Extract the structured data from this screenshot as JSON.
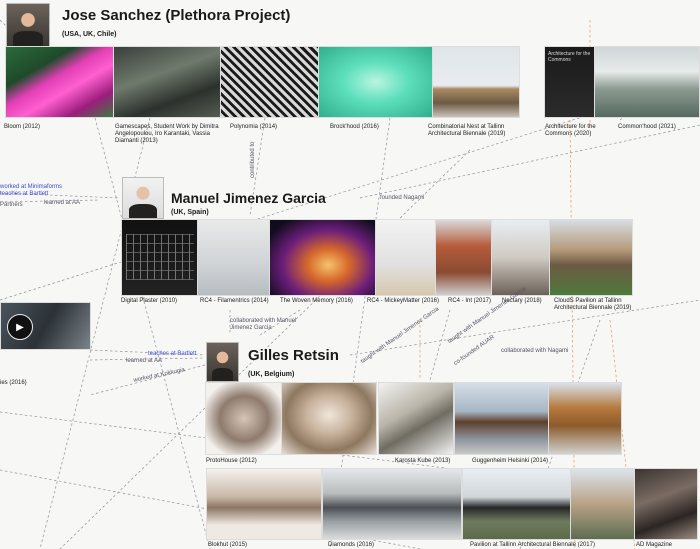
{
  "people": [
    {
      "name": "Jose Sanchez (Plethora Project)",
      "location": "(USA, UK, Chile)"
    },
    {
      "name": "Manuel Jimenez Garcia",
      "location": "(UK, Spain)"
    },
    {
      "name": "Gilles Retsin",
      "location": "(UK, Belgium)"
    }
  ],
  "projects": {
    "jose": [
      "Bloom (2012)",
      "Gamescapes, Student Work by Dimitra Angelopoulou, Iro Karantaki, Vassia Diamanti (2013)",
      "Polynomia (2014)",
      "Brock'hood (2016)",
      "Combinatorial Nest at Tallinn Architectural Biennale (2019)",
      "Architecture for the Commons (2020)",
      "Common'hood (2021)"
    ],
    "manuel": [
      "Digital Plaster (2010)",
      "RC4 - Filamentrics (2014)",
      "The Woven Memory (2016)",
      "RC4 - MickeyMatter (2016)",
      "RC4 - Int (2017)",
      "Nectary (2018)",
      "CloudS Pavilion at Tallinn Architectural Biennale (2019)"
    ],
    "gilles": [
      "ProtoHouse (2012)",
      "Karosta Kube (2013)",
      "Guggenheim Helsinki (2014)",
      "Blokhut (2015)",
      "Diamonds (2016)",
      "Pavilion at Tallinn Architectural Biennale (2017)",
      "AD Magazine"
    ],
    "left": [
      "ies (2016)"
    ]
  },
  "edges": [
    "worked at Minimaforms",
    "teaches at Bartlett",
    "learned at AA",
    "Partners",
    "contributed to",
    "founded Nagami",
    "collaborated with Manuel Jimenez Garcia",
    "taught with Manuel Jimenez Garcia",
    "taught with Manuel Jimenez Garcia",
    "co-founded AUAR",
    "collaborated with Nagami",
    "teaches at Bartlett",
    "learned at AA",
    "worked at Kokkugia"
  ],
  "video_overlay": "Architecture for the Commons",
  "icons": {
    "play": "▶"
  },
  "colors": {
    "dashed_link": "#7a7f86",
    "orange_link": "#e8924f",
    "blue_label": "#3b4bd0"
  }
}
